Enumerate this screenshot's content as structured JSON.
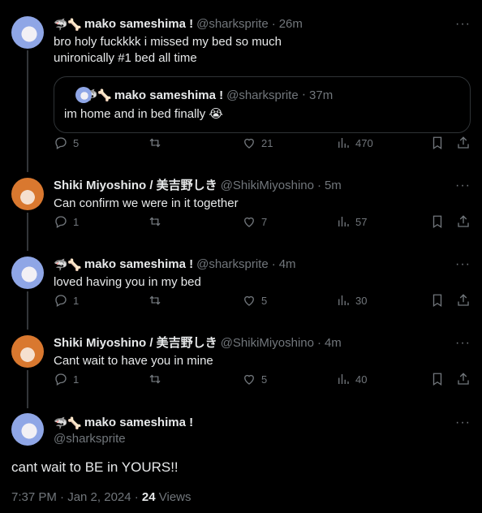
{
  "tweets": [
    {
      "name": "mako sameshima !",
      "handle": "@sharksprite",
      "time": "26m",
      "text": "bro holy fuckkkk i missed my bed so much\nunironically #1 bed all time",
      "quote": {
        "name": "mako sameshima !",
        "handle": "@sharksprite",
        "time": "37m",
        "text": "im home and in bed finally 😭"
      },
      "replies": "5",
      "retweets": "",
      "likes": "21",
      "views": "470"
    },
    {
      "name": "Shiki Miyoshino / 美吉野しき",
      "handle": "@ShikiMiyoshino",
      "time": "5m",
      "text": "Can confirm we were in it together",
      "replies": "1",
      "retweets": "",
      "likes": "7",
      "views": "57"
    },
    {
      "name": "mako sameshima !",
      "handle": "@sharksprite",
      "time": "4m",
      "text": "loved having you in my bed",
      "replies": "1",
      "retweets": "",
      "likes": "5",
      "views": "30"
    },
    {
      "name": "Shiki Miyoshino / 美吉野しき",
      "handle": "@ShikiMiyoshino",
      "time": "4m",
      "text": "Cant wait to have you in mine",
      "replies": "1",
      "retweets": "",
      "likes": "5",
      "views": "40"
    }
  ],
  "main": {
    "name": "mako sameshima !",
    "handle": "@sharksprite",
    "text": "cant wait to BE in YOURS!!",
    "timestamp": "7:37 PM · Jan 2, 2024 · ",
    "views_count": "24",
    "views_label": " Views"
  },
  "name_emoji": "🦈🦴",
  "more_glyph": "···",
  "dot": "·",
  "colors": {
    "background": "#000000",
    "text": "#e7e9ea",
    "muted": "#71767b",
    "border": "#2f3336"
  }
}
